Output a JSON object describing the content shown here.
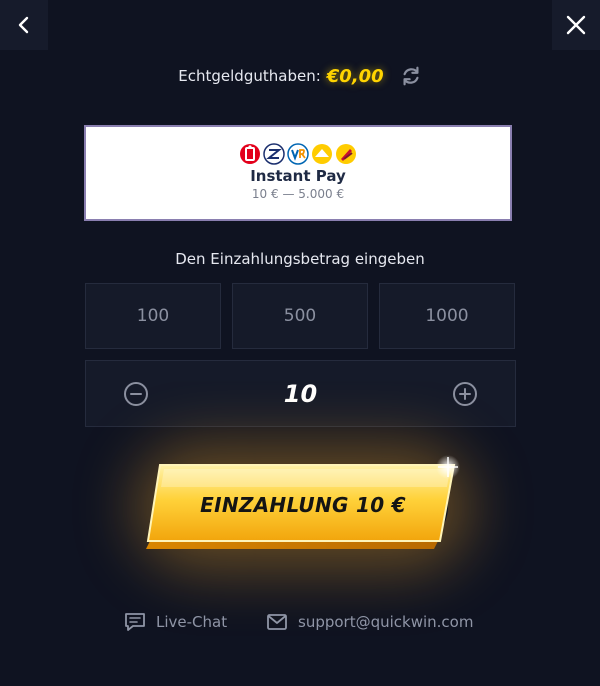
{
  "nav": {
    "back_icon": "chevron-left-icon",
    "close_icon": "close-icon"
  },
  "balance": {
    "label": "Echtgeldguthaben:",
    "value": "€0,00",
    "value_color": "#ffd400",
    "refresh_icon": "refresh-icon"
  },
  "payment_method": {
    "logos": [
      "sparkasse-icon",
      "bank-z-icon",
      "vr-icon",
      "bank-roof-icon",
      "bank-yellow-icon"
    ],
    "name": "Instant Pay",
    "range": "10 € — 5.000 €"
  },
  "deposit_form": {
    "prompt": "Den Einzahlungsbetrag eingeben",
    "presets": [
      "100",
      "500",
      "1000"
    ],
    "amount": "10",
    "minus_icon": "minus-circle-icon",
    "plus_icon": "plus-circle-icon"
  },
  "deposit_button": {
    "label": "EINZAHLUNG 10 €",
    "color": "#ffc21a"
  },
  "footer": {
    "chat_label": "Live-Chat",
    "chat_icon": "chat-icon",
    "email": "support@quickwin.com",
    "email_icon": "mail-icon"
  }
}
